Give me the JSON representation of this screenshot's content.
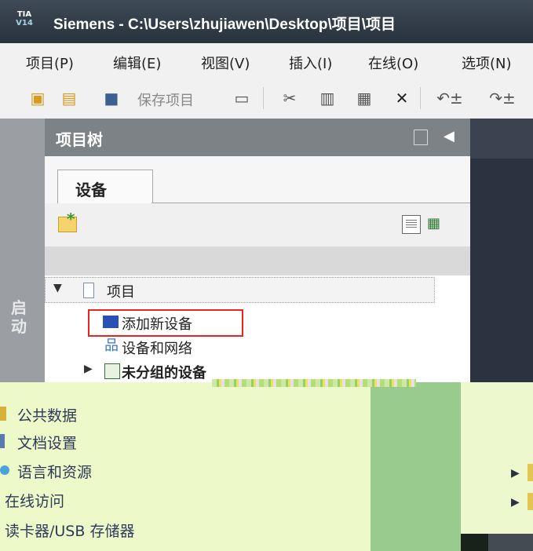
{
  "window": {
    "logo_line1": "TIA",
    "logo_line2": "V14",
    "title": "Siemens  -  C:\\Users\\zhujiawen\\Desktop\\项目\\项目"
  },
  "menu": [
    {
      "label": "项目(P)"
    },
    {
      "label": "编辑(E)"
    },
    {
      "label": "视图(V)"
    },
    {
      "label": "插入(I)"
    },
    {
      "label": "在线(O)"
    },
    {
      "label": "选项(N)"
    }
  ],
  "toolbar": {
    "save_label": "保存项目",
    "icons": [
      "new-project-icon",
      "open-project-icon",
      "save-icon",
      "print-icon",
      "cut-icon",
      "copy-icon",
      "paste-icon",
      "delete-icon",
      "undo-icon",
      "redo-icon"
    ]
  },
  "sidebar": {
    "label": "启动"
  },
  "project_tree": {
    "header_title": "项目树",
    "tab_label": "设备",
    "items": [
      {
        "label": "项目",
        "level": 0,
        "expanded": true,
        "icon": "project-icon"
      },
      {
        "label": "添加新设备",
        "level": 1,
        "icon": "add-device-icon",
        "highlighted": true
      },
      {
        "label": "设备和网络",
        "level": 1,
        "icon": "network-icon"
      },
      {
        "label": "未分组的设备",
        "level": 1,
        "collapsed": true,
        "icon": "device-group-icon"
      }
    ]
  },
  "lower_list": {
    "items": [
      {
        "label": "公共数据"
      },
      {
        "label": "文档设置"
      },
      {
        "label": "语言和资源"
      },
      {
        "label": "在线访问"
      },
      {
        "label": "读卡器/USB 存储器"
      }
    ]
  },
  "colors": {
    "highlight_border": "#e8261f",
    "header_bg": "#7d8287",
    "title_bg": "#28323d"
  }
}
